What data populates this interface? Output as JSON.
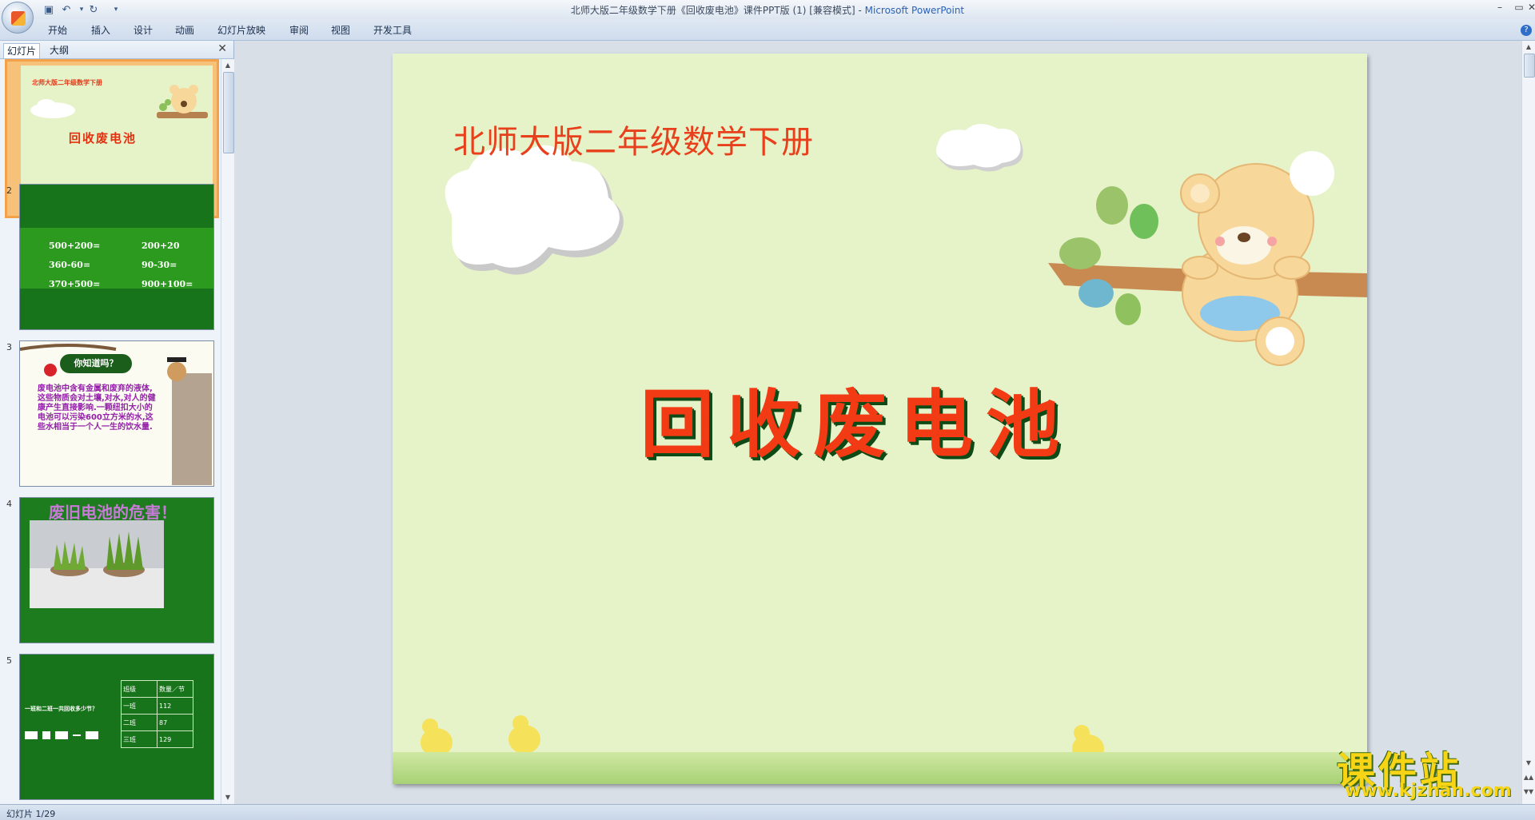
{
  "window": {
    "title_doc": "北师大版二年级数学下册《回收废电池》课件PPT版 (1) [兼容模式]",
    "title_sep": " - ",
    "title_app": "Microsoft PowerPoint"
  },
  "ribbon": {
    "tabs": [
      "开始",
      "插入",
      "设计",
      "动画",
      "幻灯片放映",
      "审阅",
      "视图",
      "开发工具"
    ]
  },
  "panel": {
    "tabs": [
      "幻灯片",
      "大纲"
    ],
    "close_glyph": "✕"
  },
  "thumbnails": [
    {
      "number": "1",
      "subtitle": "北师大版二年级数学下册",
      "title": "回收废电池"
    },
    {
      "number": "2",
      "problems": [
        "500+200=",
        "200+20",
        "360-60=",
        "90-30=",
        "370+500=",
        "900+100="
      ]
    },
    {
      "number": "3",
      "bubble": "你知道吗？",
      "body": "废电池中含有金属和废弃的液体,这些物质会对土壤,对水,对人的健康产生直接影响.一颗纽扣大小的电池可以污染600立方米的水,这些水相当于一个人一生的饮水量."
    },
    {
      "number": "4",
      "heading": "废旧电池的危害！"
    },
    {
      "number": "5",
      "question": "一班和二班一共回收多少节？",
      "table": [
        [
          "班级",
          "数量／节"
        ],
        [
          "一班",
          "112"
        ],
        [
          "二班",
          "87"
        ],
        [
          "三班",
          "129"
        ]
      ]
    }
  ],
  "slide": {
    "subtitle": "北师大版二年级数学下册",
    "title": "回收废电池"
  },
  "status": {
    "text": "幻灯片 1/29"
  },
  "watermark": {
    "main": "课件站",
    "url": "www.kjzhan.com"
  }
}
